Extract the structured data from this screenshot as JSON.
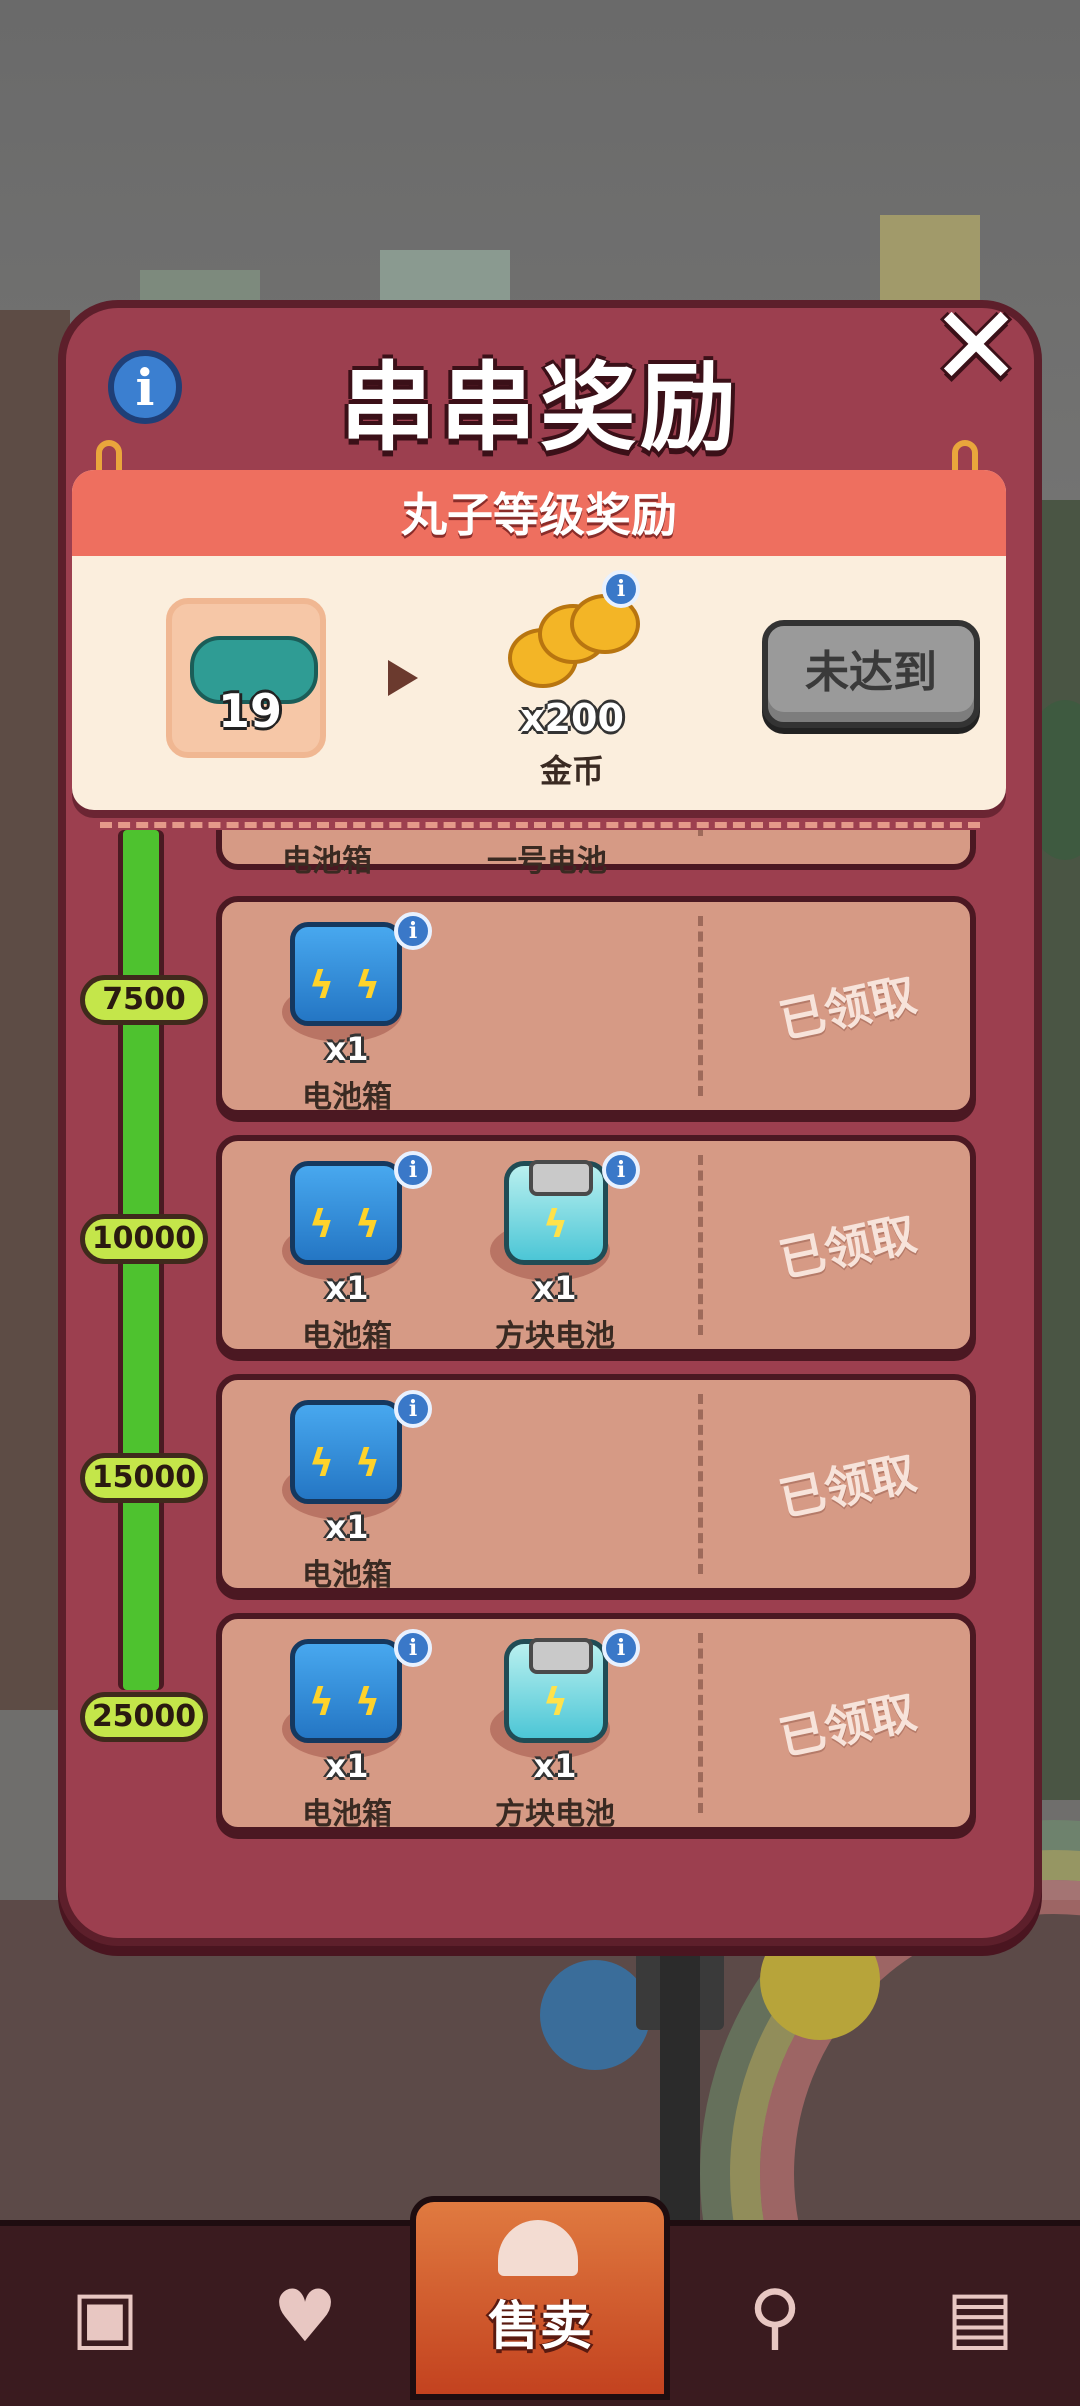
{
  "dialog": {
    "title": "串串奖励",
    "close_glyph": "✕",
    "info_glyph": "i"
  },
  "level_reward": {
    "header": "丸子等级奖励",
    "current_level": "19",
    "reward_qty": "x200",
    "reward_name": "金币",
    "status_button": "未达到"
  },
  "partial_row": {
    "item1_name": "电池箱",
    "item2_name": "一号电池"
  },
  "progress": {
    "fill_fraction": 1.0
  },
  "rows": [
    {
      "threshold": "7500",
      "items": [
        {
          "qty": "x1",
          "name": "电池箱",
          "icon": "battery-box-icon"
        }
      ],
      "status": "已领取"
    },
    {
      "threshold": "10000",
      "items": [
        {
          "qty": "x1",
          "name": "电池箱",
          "icon": "battery-box-icon"
        },
        {
          "qty": "x1",
          "name": "方块电池",
          "icon": "block-battery-icon"
        }
      ],
      "status": "已领取"
    },
    {
      "threshold": "15000",
      "items": [
        {
          "qty": "x1",
          "name": "电池箱",
          "icon": "battery-box-icon"
        }
      ],
      "status": "已领取"
    },
    {
      "threshold": "25000",
      "items": [
        {
          "qty": "x1",
          "name": "电池箱",
          "icon": "battery-box-icon"
        },
        {
          "qty": "x1",
          "name": "方块电池",
          "icon": "block-battery-icon"
        }
      ],
      "status": "已领取"
    }
  ],
  "bottom_nav": {
    "active_label": "售卖",
    "items": [
      "shop-bag-icon",
      "skewer-icon",
      "sell-bell-icon",
      "person-pin-icon",
      "bus-icon"
    ]
  },
  "colors": {
    "panel": "#9c3f4f",
    "accent_strip": "#ee6f5f",
    "progress": "#4ec22f",
    "threshold_pill": "#c4e64a"
  }
}
